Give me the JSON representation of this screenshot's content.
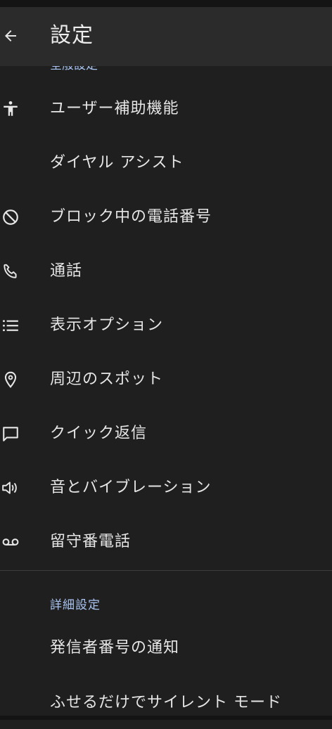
{
  "app_bar": {
    "title": "設定"
  },
  "general_section": {
    "header": "全般設定",
    "items": [
      {
        "label": "ユーザー補助機能",
        "icon": "accessibility-icon"
      },
      {
        "label": "ダイヤル アシスト",
        "icon": ""
      },
      {
        "label": "ブロック中の電話番号",
        "icon": "block-icon"
      },
      {
        "label": "通話",
        "icon": "phone-icon"
      },
      {
        "label": "表示オプション",
        "icon": "list-icon"
      },
      {
        "label": "周辺のスポット",
        "icon": "location-pin-icon"
      },
      {
        "label": "クイック返信",
        "icon": "chat-bubble-icon"
      },
      {
        "label": "音とバイブレーション",
        "icon": "volume-icon"
      },
      {
        "label": "留守番電話",
        "icon": "voicemail-icon"
      }
    ]
  },
  "advanced_section": {
    "header": "詳細設定",
    "items": [
      {
        "label": "発信者番号の通知"
      },
      {
        "label": "ふせるだけでサイレント モード"
      }
    ]
  },
  "colors": {
    "background": "#1f1f1f",
    "app_bar": "#2b2b2b",
    "text": "#e6e6e6",
    "section_header": "#a8c3f0"
  }
}
